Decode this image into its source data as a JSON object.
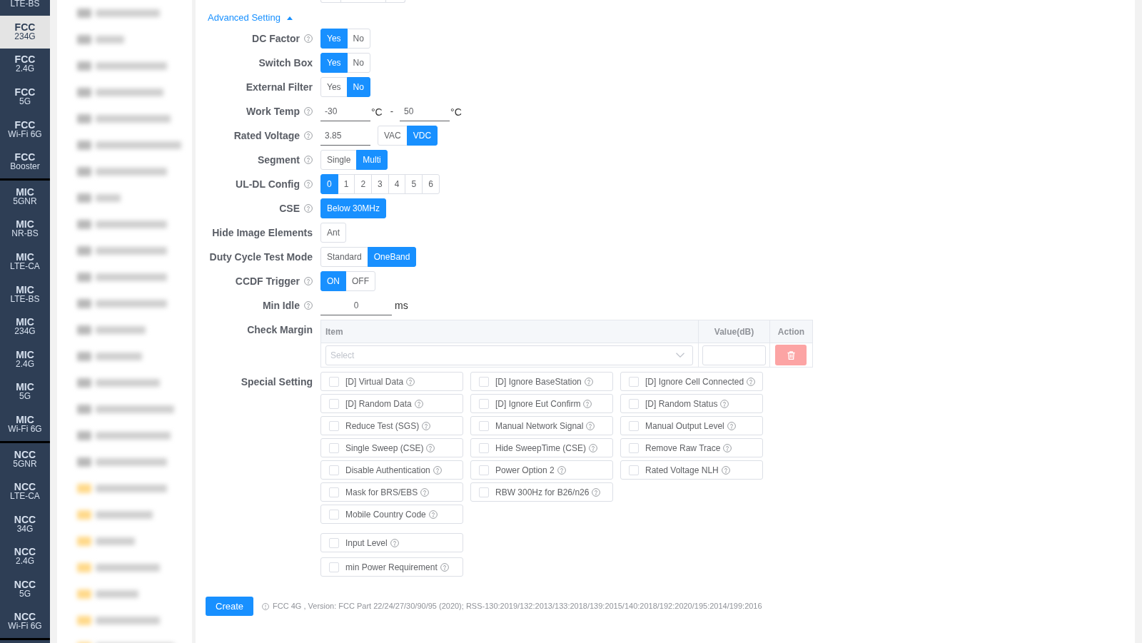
{
  "sidebar": {
    "groups": [
      {
        "items": [
          {
            "subtitle": "LTE-BS",
            "selected": false
          },
          {
            "title": "FCC",
            "subtitle": "234G",
            "selected": true
          },
          {
            "title": "FCC",
            "subtitle": "2.4G",
            "selected": false
          },
          {
            "title": "FCC",
            "subtitle": "5G",
            "selected": false
          },
          {
            "title": "FCC",
            "subtitle": "Wi-Fi 6G",
            "selected": false
          },
          {
            "title": "FCC",
            "subtitle": "Booster",
            "selected": false
          }
        ]
      },
      {
        "items": [
          {
            "title": "MIC",
            "subtitle": "5GNR",
            "selected": false
          },
          {
            "title": "MIC",
            "subtitle": "NR-BS",
            "selected": false
          },
          {
            "title": "MIC",
            "subtitle": "LTE-CA",
            "selected": false
          },
          {
            "title": "MIC",
            "subtitle": "LTE-BS",
            "selected": false
          },
          {
            "title": "MIC",
            "subtitle": "234G",
            "selected": false
          },
          {
            "title": "MIC",
            "subtitle": "2.4G",
            "selected": false
          },
          {
            "title": "MIC",
            "subtitle": "5G",
            "selected": false
          },
          {
            "title": "MIC",
            "subtitle": "Wi-Fi 6G",
            "selected": false
          }
        ]
      },
      {
        "items": [
          {
            "title": "NCC",
            "subtitle": "5GNR",
            "selected": false
          },
          {
            "title": "NCC",
            "subtitle": "LTE-CA",
            "selected": false
          },
          {
            "title": "NCC",
            "subtitle": "34G",
            "selected": false
          },
          {
            "title": "NCC",
            "subtitle": "2.4G",
            "selected": false
          },
          {
            "title": "NCC",
            "subtitle": "5G",
            "selected": false
          },
          {
            "title": "NCC",
            "subtitle": "Wi-Fi 6G",
            "selected": false
          }
        ]
      }
    ]
  },
  "advanced_setting": {
    "label": "Advanced Setting",
    "expanded": true
  },
  "form": {
    "rows": [
      {
        "kind": "segmented",
        "label": "DC Factor",
        "help": true,
        "options": [
          {
            "label": "Yes",
            "selected": true
          },
          {
            "label": "No",
            "selected": false
          }
        ]
      },
      {
        "kind": "segmented",
        "label": "Switch Box",
        "help": false,
        "options": [
          {
            "label": "Yes",
            "selected": true
          },
          {
            "label": "No",
            "selected": false
          }
        ]
      },
      {
        "kind": "segmented",
        "label": "External Filter",
        "help": false,
        "options": [
          {
            "label": "Yes",
            "selected": false
          },
          {
            "label": "No",
            "selected": true
          }
        ]
      },
      {
        "kind": "range",
        "label": "Work Temp",
        "help": true,
        "inputs": [
          {
            "value": "-30",
            "unit": "°C"
          },
          {
            "value": "50",
            "unit": "°C"
          }
        ],
        "separator": "-"
      },
      {
        "kind": "input_segmented",
        "label": "Rated Voltage",
        "help": true,
        "value": "3.85",
        "options": [
          {
            "label": "VAC",
            "selected": false
          },
          {
            "label": "VDC",
            "selected": true
          }
        ]
      },
      {
        "kind": "segmented",
        "label": "Segment",
        "help": true,
        "options": [
          {
            "label": "Single",
            "selected": false
          },
          {
            "label": "Multi",
            "selected": true
          }
        ]
      },
      {
        "kind": "segmented",
        "label": "UL-DL Config",
        "help": true,
        "options": [
          {
            "label": "0",
            "selected": true
          },
          {
            "label": "1",
            "selected": false
          },
          {
            "label": "2",
            "selected": false
          },
          {
            "label": "3",
            "selected": false
          },
          {
            "label": "4",
            "selected": false
          },
          {
            "label": "5",
            "selected": false
          },
          {
            "label": "6",
            "selected": false
          }
        ]
      },
      {
        "kind": "segmented",
        "label": "CSE",
        "help": true,
        "options": [
          {
            "label": "Below 30MHz",
            "selected": true
          }
        ]
      },
      {
        "kind": "segmented",
        "label": "Hide Image Elements",
        "help": false,
        "options": [
          {
            "label": "Ant",
            "selected": false
          }
        ]
      },
      {
        "kind": "segmented",
        "label": "Duty Cycle Test Mode",
        "help": false,
        "options": [
          {
            "label": "Standard",
            "selected": false
          },
          {
            "label": "OneBand",
            "selected": true
          }
        ]
      },
      {
        "kind": "segmented",
        "label": "CCDF Trigger",
        "help": true,
        "options": [
          {
            "label": "ON",
            "selected": true
          },
          {
            "label": "OFF",
            "selected": false
          }
        ]
      },
      {
        "kind": "input",
        "label": "Min Idle",
        "help": true,
        "value": "0",
        "unit": "ms"
      },
      {
        "kind": "table",
        "label": "Check Margin",
        "help": false,
        "columns": [
          "Item",
          "Value(dB)",
          "Action"
        ],
        "rows": [
          {
            "placeholder": "Select"
          }
        ]
      },
      {
        "kind": "checkboxes",
        "label": "Special Setting",
        "help": false,
        "columns": [
          [
            {
              "label": "[D] Virtual Data",
              "checked": false
            },
            {
              "label": "[D] Random Data",
              "checked": false
            },
            {
              "label": "Reduce Test (SGS)",
              "checked": false
            },
            {
              "label": "Single Sweep (CSE)",
              "checked": false
            },
            {
              "label": "Disable Authentication",
              "checked": false
            },
            {
              "label": "Mask for BRS/EBS",
              "checked": false
            },
            {
              "label": "Mobile Country Code",
              "checked": false
            }
          ],
          [
            {
              "label": "[D] Ignore BaseStation",
              "checked": false
            },
            {
              "label": "[D] Ignore Eut Confirm",
              "checked": false
            },
            {
              "label": "Manual Network Signal",
              "checked": false
            },
            {
              "label": "Hide SweepTime (CSE)",
              "checked": false
            },
            {
              "label": "Power Option 2",
              "checked": false
            },
            {
              "label": "RBW 300Hz for B26/n26",
              "checked": false
            }
          ],
          [
            {
              "label": "[D] Ignore Cell Connected",
              "checked": false
            },
            {
              "label": "[D] Random Status",
              "checked": false
            },
            {
              "label": "Manual Output Level",
              "checked": false
            },
            {
              "label": "Remove Raw Trace",
              "checked": false
            },
            {
              "label": "Rated Voltage NLH",
              "checked": false
            }
          ]
        ],
        "extra": [
          {
            "label": "Input Level",
            "checked": false
          },
          {
            "label": "min Power Requirement",
            "checked": false
          }
        ]
      }
    ]
  },
  "footer": {
    "create_button": "Create",
    "version_note": "FCC 4G , Version: FCC Part 22/24/27/30/90/95 (2020); RSS-130:2019/132:2013/133:2018/139:2015/140:2018/192:2020/195:2014/199:2016"
  }
}
